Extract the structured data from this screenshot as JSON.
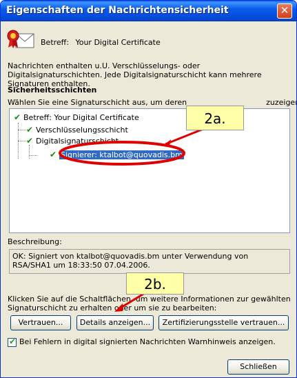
{
  "window": {
    "title": "Eigenschaften der Nachrichtensicherheit",
    "close_glyph": "✕"
  },
  "subject": {
    "label": "Betreff:",
    "value": "Your Digital Certificate"
  },
  "intro_text": "Nachrichten enthalten u.U. Verschlüsselungs- oder Digitalsignaturschichten. Jede Digitalsignaturschicht kann mehrere Signaturen enthalten.",
  "layers": {
    "heading": "Sicherheitsschichten",
    "hint_start": "Wählen Sie eine Signaturschicht aus, um deren",
    "hint_end": "zuzeigen.",
    "tree": [
      {
        "label": "Betreff: Your Digital Certificate"
      },
      {
        "label": "Verschlüsselungsschicht"
      },
      {
        "label": "Digitalsignaturschicht"
      },
      {
        "label": "Signierer: ktalbot@quovadis.bm"
      }
    ]
  },
  "description": {
    "label": "Beschreibung:",
    "text": "OK: Signiert von ktalbot@quovadis.bm unter Verwendung von RSA/SHA1 um 18:33:50 07.04.2006."
  },
  "help_text": "Klicken Sie auf die Schaltflächen, um weitere Informationen zur gewählten Signaturschicht zu erhalten oder um sie zu bearbeiten:",
  "buttons": {
    "trust": "Vertrauen...",
    "details": "Details anzeigen...",
    "trust_ca": "Zertifizierungsstelle vertrauen...",
    "close": "Schließen"
  },
  "warning_checkbox": {
    "label": "Bei Fehlern in digital signierten Nachrichten Warnhinweis anzeigen.",
    "checked": true
  },
  "annotations": {
    "callout_a": "2a.",
    "callout_b": "2b.",
    "accent_red": "#e00000"
  },
  "icons": {
    "certificate": "certificate-seal-envelope-icon",
    "check": "green-checkmark-icon"
  }
}
